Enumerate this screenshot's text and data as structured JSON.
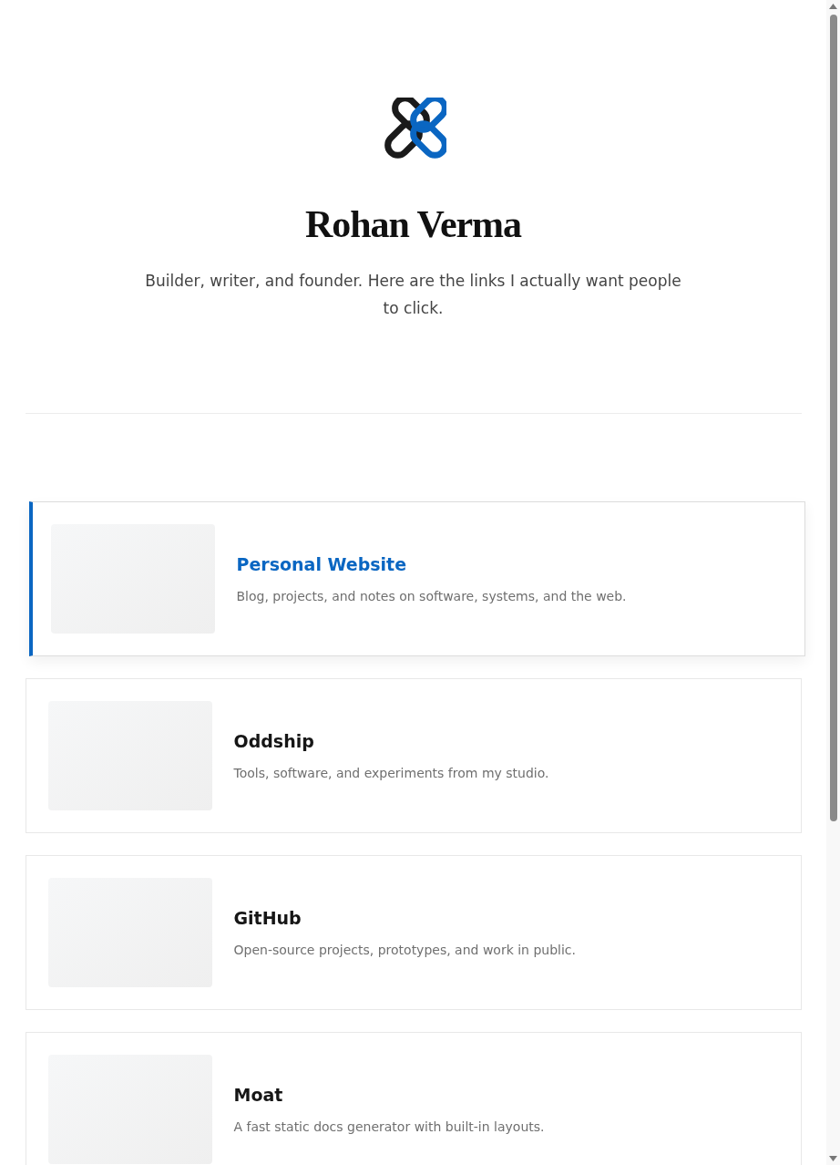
{
  "profile": {
    "name": "Rohan Verma",
    "bio": "Builder, writer, and founder. Here are the links I actually want people to click."
  },
  "links": [
    {
      "title": "Personal Website",
      "description": "Blog, projects, and notes on software, systems, and the web.",
      "selected": true
    },
    {
      "title": "Oddship",
      "description": "Tools, software, and experiments from my studio.",
      "selected": false
    },
    {
      "title": "GitHub",
      "description": "Open-source projects, prototypes, and work in public.",
      "selected": false
    },
    {
      "title": "Moat",
      "description": "A fast static docs generator with built-in layouts.",
      "selected": false
    }
  ]
}
